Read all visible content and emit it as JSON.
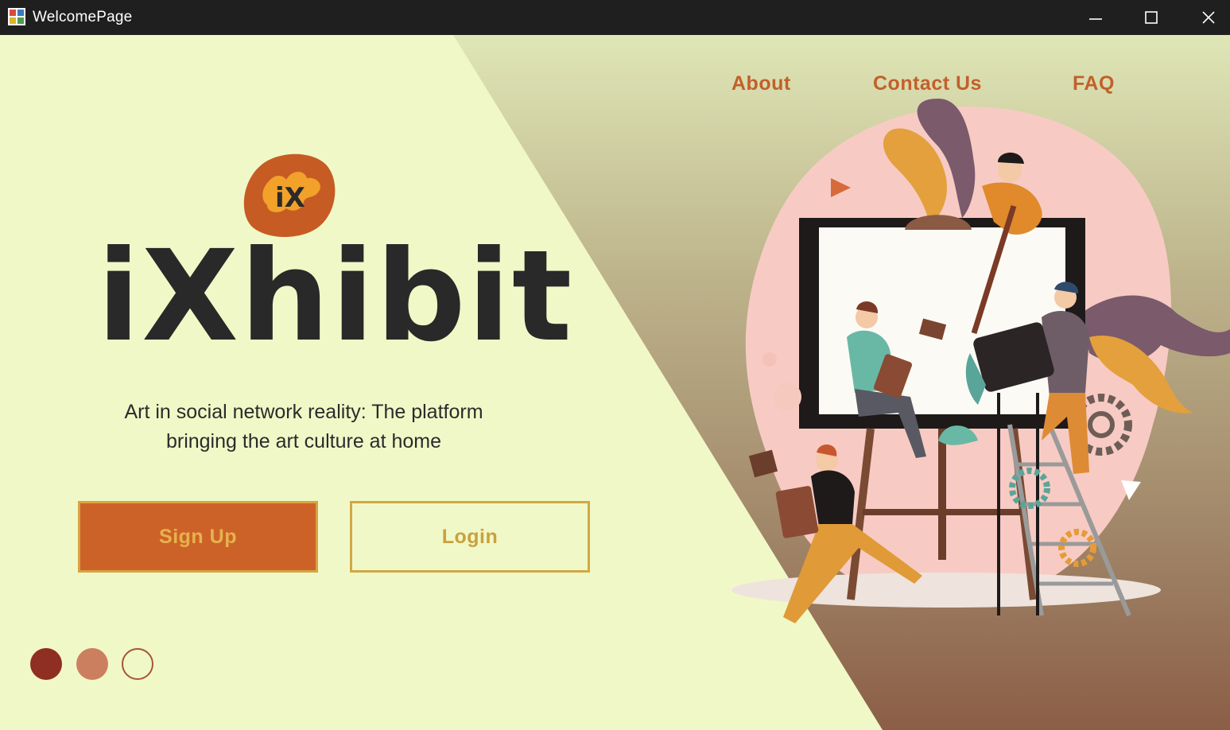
{
  "window": {
    "title": "WelcomePage",
    "controls": [
      "minimize",
      "maximize",
      "close"
    ]
  },
  "nav": {
    "about": "About",
    "contact": "Contact Us",
    "faq": "FAQ"
  },
  "hero": {
    "logo_mark": "iX",
    "brand": "iXhibit",
    "tagline": "Art in social network reality: The platform bringing the art culture at home"
  },
  "buttons": {
    "signup": "Sign Up",
    "login": "Login"
  },
  "carousel": {
    "dots": 3,
    "active_index": 0,
    "colors": [
      "#8f2e22",
      "#cc7f5f",
      "#f1f8c7"
    ]
  },
  "theme": {
    "background": "#f1f8c7",
    "accent": "#cd6228",
    "gold": "#d0a843",
    "text_dark": "#292929"
  },
  "icons": {
    "app": "app-icon",
    "minimize": "minimize-icon",
    "maximize": "maximize-icon",
    "close": "close-icon"
  }
}
